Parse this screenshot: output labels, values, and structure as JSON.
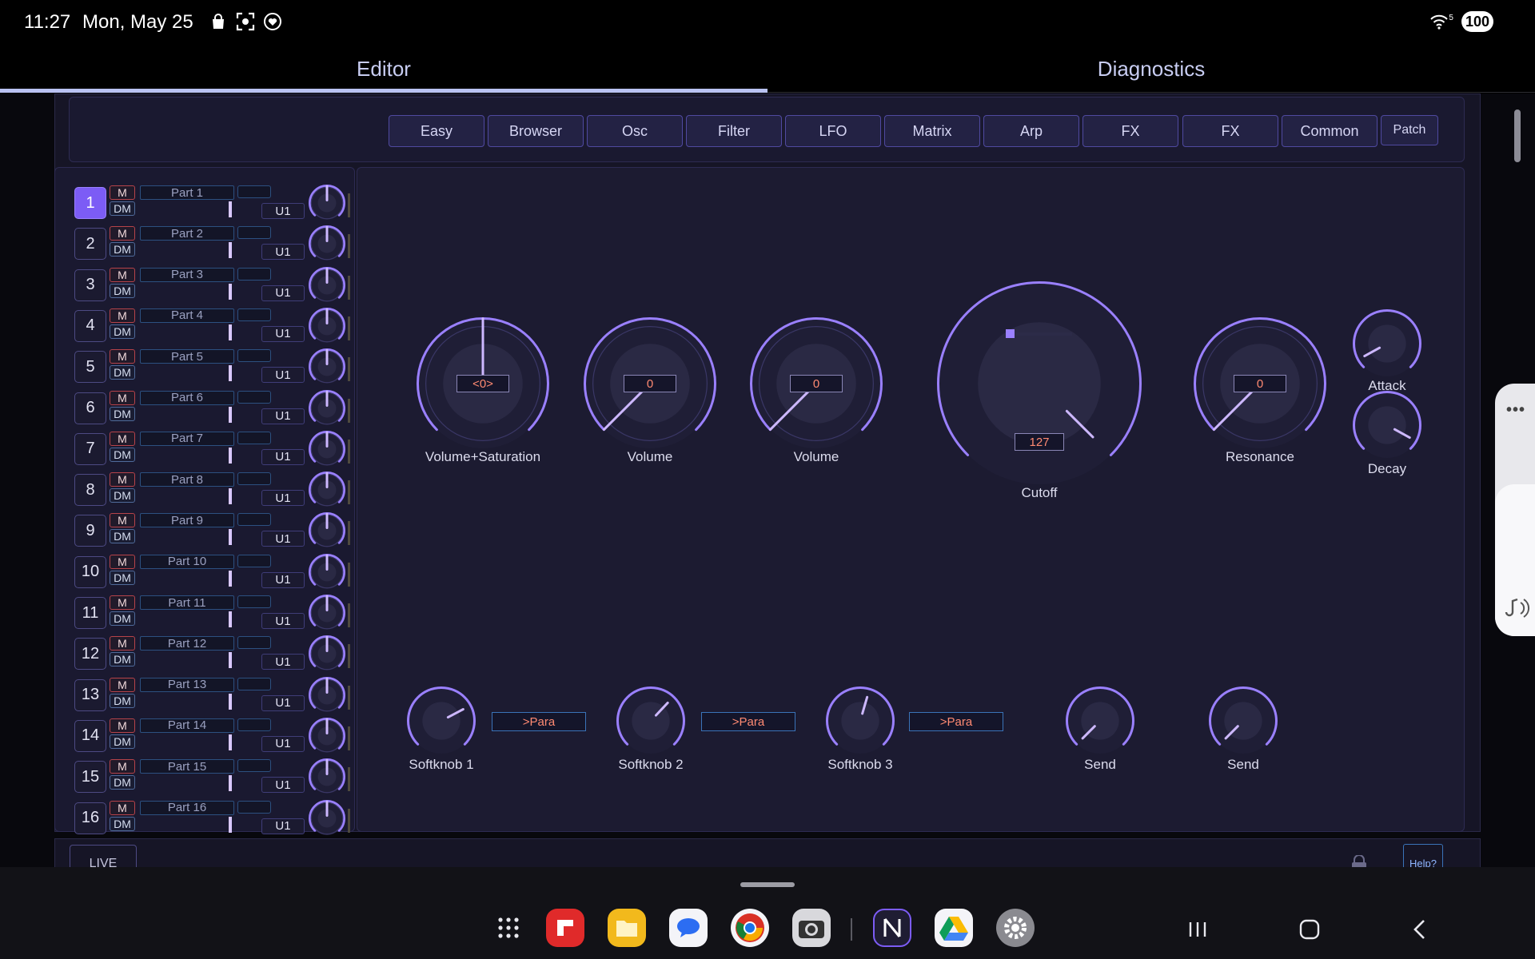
{
  "status": {
    "time": "11:27",
    "date": "Mon, May 25",
    "battery": "100",
    "wifi_badge": "5"
  },
  "tabs": [
    {
      "label": "Editor",
      "active": true
    },
    {
      "label": "Diagnostics",
      "active": false
    }
  ],
  "nav_buttons": [
    "Easy",
    "Browser",
    "Osc",
    "Filter",
    "LFO",
    "Matrix",
    "Arp",
    "FX",
    "FX",
    "Common",
    "Patch"
  ],
  "parts": [
    {
      "num": "1",
      "name": "Part 1",
      "mute": "M",
      "dm": "DM",
      "slot": "U1",
      "selected": true
    },
    {
      "num": "2",
      "name": "Part 2",
      "mute": "M",
      "dm": "DM",
      "slot": "U1"
    },
    {
      "num": "3",
      "name": "Part 3",
      "mute": "M",
      "dm": "DM",
      "slot": "U1"
    },
    {
      "num": "4",
      "name": "Part 4",
      "mute": "M",
      "dm": "DM",
      "slot": "U1"
    },
    {
      "num": "5",
      "name": "Part 5",
      "mute": "M",
      "dm": "DM",
      "slot": "U1"
    },
    {
      "num": "6",
      "name": "Part 6",
      "mute": "M",
      "dm": "DM",
      "slot": "U1"
    },
    {
      "num": "7",
      "name": "Part 7",
      "mute": "M",
      "dm": "DM",
      "slot": "U1"
    },
    {
      "num": "8",
      "name": "Part 8",
      "mute": "M",
      "dm": "DM",
      "slot": "U1"
    },
    {
      "num": "9",
      "name": "Part 9",
      "mute": "M",
      "dm": "DM",
      "slot": "U1"
    },
    {
      "num": "10",
      "name": "Part 10",
      "mute": "M",
      "dm": "DM",
      "slot": "U1"
    },
    {
      "num": "11",
      "name": "Part 11",
      "mute": "M",
      "dm": "DM",
      "slot": "U1"
    },
    {
      "num": "12",
      "name": "Part 12",
      "mute": "M",
      "dm": "DM",
      "slot": "U1"
    },
    {
      "num": "13",
      "name": "Part 13",
      "mute": "M",
      "dm": "DM",
      "slot": "U1"
    },
    {
      "num": "14",
      "name": "Part 14",
      "mute": "M",
      "dm": "DM",
      "slot": "U1"
    },
    {
      "num": "15",
      "name": "Part 15",
      "mute": "M",
      "dm": "DM",
      "slot": "U1"
    },
    {
      "num": "16",
      "name": "Part 16",
      "mute": "M",
      "dm": "DM",
      "slot": "U1"
    }
  ],
  "main_knobs": [
    {
      "label": "Volume+Saturation",
      "value_text": "<0>",
      "level": 0.5
    },
    {
      "label": "Volume",
      "value_text": "0",
      "level": 0.0
    },
    {
      "label": "Volume",
      "value_text": "0",
      "level": 0.0
    },
    {
      "label": "Cutoff",
      "value_text": "127",
      "level": 1.0
    },
    {
      "label": "Resonance",
      "value_text": "0",
      "level": 0.0
    },
    {
      "label": "Attack",
      "level": 0.06
    },
    {
      "label": "Decay",
      "level": 0.94
    }
  ],
  "softknobs": [
    {
      "label": "Softknob 1",
      "level": 0.73,
      "para": ">Para"
    },
    {
      "label": "Softknob 2",
      "level": 0.66,
      "para": ">Para"
    },
    {
      "label": "Softknob 3",
      "level": 0.56,
      "para": ">Para"
    }
  ],
  "sends": [
    {
      "label": "Send",
      "level": 0.0
    },
    {
      "label": "Send",
      "level": 0.0
    }
  ],
  "part_knob_level": 0.5,
  "bottom": {
    "live": "LIVE",
    "help": "Help?"
  },
  "colors": {
    "accent": "#7c5cf5",
    "knob_arc": "#9a80ff",
    "value_text": "#ff8a72",
    "panel": "#1c1b31"
  },
  "dock_apps": [
    "apps-grid-icon",
    "flipboard-app-icon",
    "files-app-icon",
    "messages-app-icon",
    "chrome-app-icon",
    "camera-app-icon",
    "synth-editor-app-icon",
    "drive-app-icon",
    "settings-app-icon"
  ]
}
